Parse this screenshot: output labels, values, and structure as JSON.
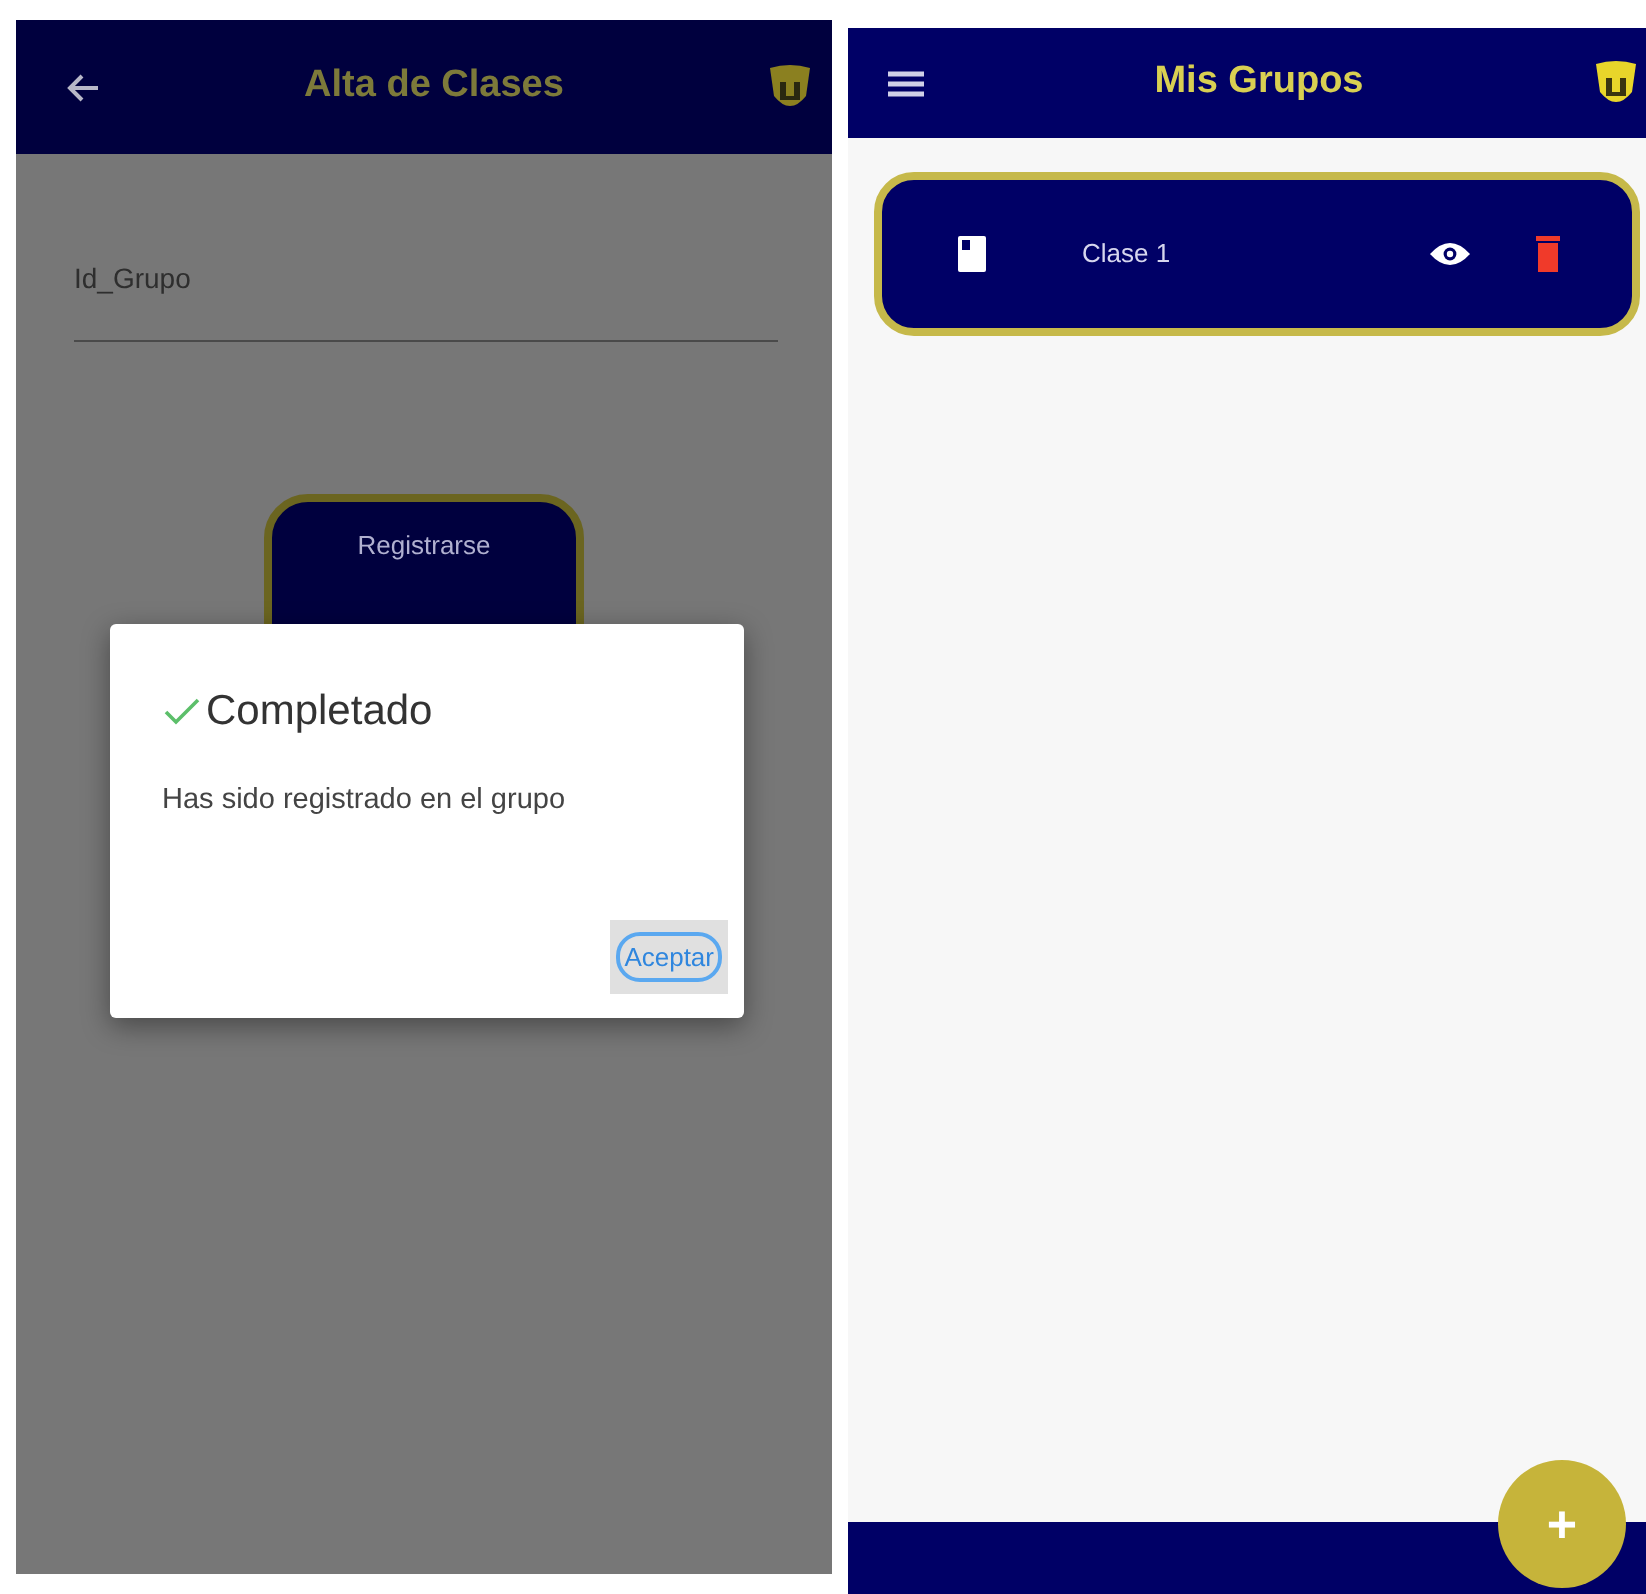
{
  "left_screen": {
    "app_bar": {
      "title": "Alta de Clases"
    },
    "field": {
      "placeholder": "Id_Grupo"
    },
    "register_button": {
      "label": "Registrarse"
    },
    "dialog": {
      "title": "Completado",
      "message": "Has sido registrado en el grupo",
      "button": "Aceptar"
    }
  },
  "right_screen": {
    "app_bar": {
      "title": "Mis Grupos"
    },
    "groups": [
      {
        "name": "Clase 1"
      }
    ],
    "fab": {
      "label": "+"
    }
  }
}
